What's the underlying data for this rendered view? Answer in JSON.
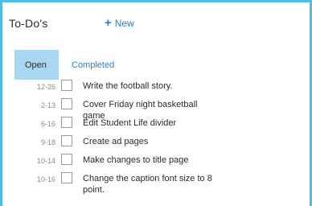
{
  "header": {
    "title": "To-Do's",
    "new_label": "New"
  },
  "tabs": [
    {
      "label": "Open",
      "active": true
    },
    {
      "label": "Completed",
      "active": false
    }
  ],
  "tasks": [
    {
      "date": "12-26",
      "text": "Write the football story."
    },
    {
      "date": "2-13",
      "text": "Cover Friday night basketball game"
    },
    {
      "date": "6-16",
      "text": "Edit Student Life divider"
    },
    {
      "date": "9-18",
      "text": "Create ad pages"
    },
    {
      "date": "10-14",
      "text": "Make changes to title page"
    },
    {
      "date": "10-16",
      "text": "Change the caption font size to 8 point."
    }
  ],
  "colors": {
    "border": "#4cbde6",
    "link": "#2f7fc9",
    "active_tab_bg": "#a9d7f1"
  },
  "icons": {
    "new": "plus-icon"
  }
}
